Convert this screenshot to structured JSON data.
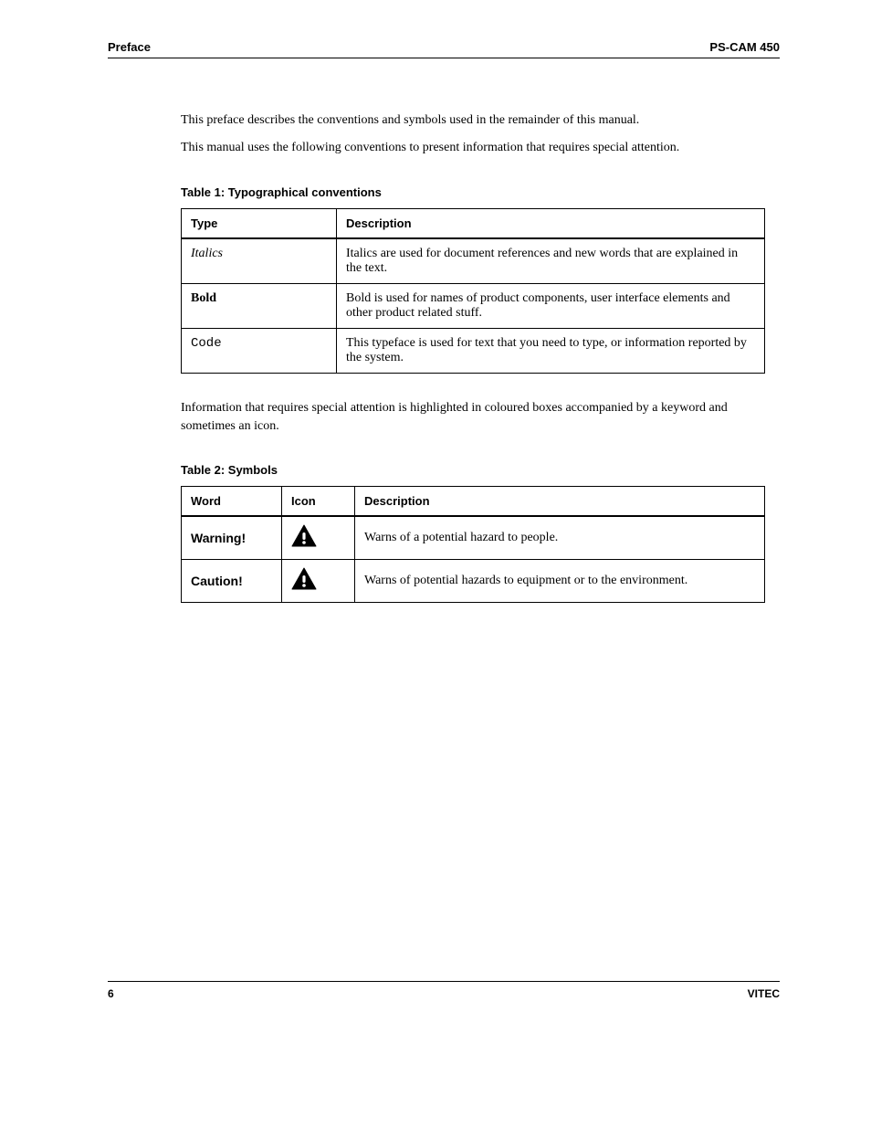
{
  "header": {
    "left": "Preface",
    "right": "PS-CAM 450"
  },
  "intro": {
    "p1": "This preface describes the conventions and symbols used in the remainder of this manual.",
    "p2": "This manual uses the following conventions to present information that requires special attention."
  },
  "table1": {
    "caption": "Table 1: Typographical conventions",
    "headers": {
      "c1": "Type",
      "c2": "Description"
    },
    "rows": [
      {
        "c1": "Italics",
        "c2": "Italics are used for document references and new words that are explained in the text."
      },
      {
        "c1": "Bold",
        "c2": "Bold is used for names of product components, user interface elements and other product related stuff."
      },
      {
        "c1": "Code",
        "c2": "This typeface is used for text that you need to type, or information reported by the system."
      }
    ]
  },
  "intro3": "Information that requires special attention is highlighted in coloured boxes accompanied by a keyword and sometimes an icon.",
  "table2": {
    "caption": "Table 2: Symbols",
    "headers": {
      "c1": "Word",
      "c2": "Icon",
      "c3": "Description"
    },
    "rows": [
      {
        "c1": "Warning!",
        "icon": "warning-icon",
        "c3": "Warns of a potential hazard to people."
      },
      {
        "c1": "Caution!",
        "icon": "warning-icon",
        "c3": "Warns of potential hazards to equipment or to the environment."
      }
    ]
  },
  "footer": {
    "left": "6",
    "right": "VITEC"
  }
}
